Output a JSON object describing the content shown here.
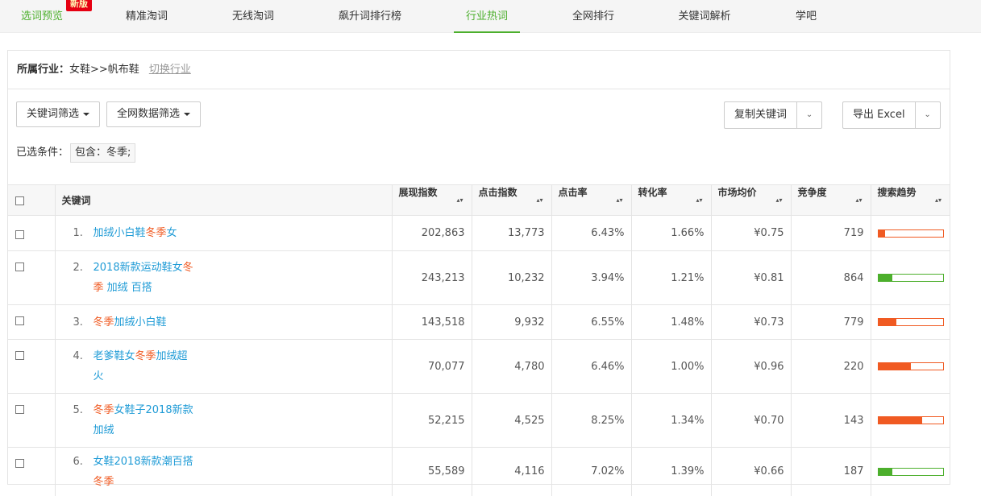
{
  "tabs": [
    {
      "label": "选词预览",
      "badge": "新版"
    },
    {
      "label": "精准淘词"
    },
    {
      "label": "无线淘词"
    },
    {
      "label": "飙升词排行榜"
    },
    {
      "label": "行业热词"
    },
    {
      "label": "全网排行"
    },
    {
      "label": "关键词解析"
    },
    {
      "label": "学吧"
    }
  ],
  "industry": {
    "label": "所属行业：",
    "value": "女鞋>>帆布鞋",
    "switch_label": "切换行业"
  },
  "toolbar": {
    "keyword_filter": "关键词筛选",
    "network_filter": "全网数据筛选",
    "copy_keywords": "复制关键词",
    "export_excel": "导出 Excel"
  },
  "conditions": {
    "label": "已选条件：",
    "tag": "包含：冬季;"
  },
  "table": {
    "headers": [
      "关键词",
      "展现指数",
      "点击指数",
      "点击率",
      "转化率",
      "市场均价",
      "竞争度",
      "搜索趋势"
    ],
    "rows": [
      {
        "idx": "1.",
        "kw_parts": [
          [
            "加绒小白鞋",
            false
          ],
          [
            "冬季",
            true
          ],
          [
            "女",
            false
          ]
        ],
        "impressions": "202,863",
        "clicks": "13,773",
        "ctr": "6.43%",
        "cvr": "1.66%",
        "price": "¥0.75",
        "competition": "719",
        "trend": 0.1,
        "trend_color": "#f05a22"
      },
      {
        "idx": "2.",
        "kw_parts": [
          [
            "2018新款运动鞋女",
            false
          ],
          [
            "冬季",
            true
          ],
          [
            " 加绒 百搭",
            false
          ]
        ],
        "impressions": "243,213",
        "clicks": "10,232",
        "ctr": "3.94%",
        "cvr": "1.21%",
        "price": "¥0.81",
        "competition": "864",
        "trend": 0.22,
        "trend_color": "#4caf2c"
      },
      {
        "idx": "3.",
        "kw_parts": [
          [
            "冬季",
            true
          ],
          [
            "加绒小白鞋",
            false
          ]
        ],
        "impressions": "143,518",
        "clicks": "9,932",
        "ctr": "6.55%",
        "cvr": "1.48%",
        "price": "¥0.73",
        "competition": "779",
        "trend": 0.28,
        "trend_color": "#f05a22"
      },
      {
        "idx": "4.",
        "kw_parts": [
          [
            "老爹鞋女",
            false
          ],
          [
            "冬季",
            true
          ],
          [
            "加绒超火",
            false
          ]
        ],
        "impressions": "70,077",
        "clicks": "4,780",
        "ctr": "6.46%",
        "cvr": "1.00%",
        "price": "¥0.96",
        "competition": "220",
        "trend": 0.5,
        "trend_color": "#f05a22"
      },
      {
        "idx": "5.",
        "kw_parts": [
          [
            "冬季",
            true
          ],
          [
            "女鞋子2018新款加绒",
            false
          ]
        ],
        "impressions": "52,215",
        "clicks": "4,525",
        "ctr": "8.25%",
        "cvr": "1.34%",
        "price": "¥0.70",
        "competition": "143",
        "trend": 0.68,
        "trend_color": "#f05a22"
      },
      {
        "idx": "6.",
        "kw_parts": [
          [
            "女鞋2018新款潮百搭",
            false
          ],
          [
            "冬季",
            true
          ]
        ],
        "impressions": "55,589",
        "clicks": "4,116",
        "ctr": "7.02%",
        "cvr": "1.39%",
        "price": "¥0.66",
        "competition": "187",
        "trend": 0.22,
        "trend_color": "#4caf2c"
      }
    ]
  }
}
